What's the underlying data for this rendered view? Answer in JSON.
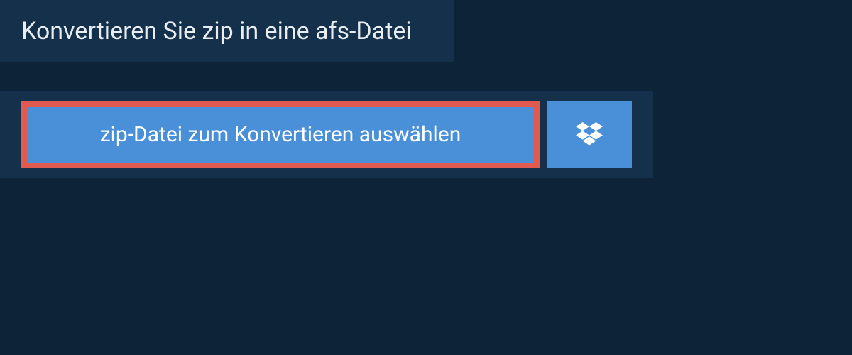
{
  "header": {
    "title": "Konvertieren Sie zip in eine afs-Datei"
  },
  "actions": {
    "select_file_label": "zip-Datei zum Konvertieren auswählen"
  },
  "colors": {
    "background": "#0d2438",
    "panel": "#14304a",
    "button": "#4a90d9",
    "highlight_border": "#e05a4f"
  }
}
